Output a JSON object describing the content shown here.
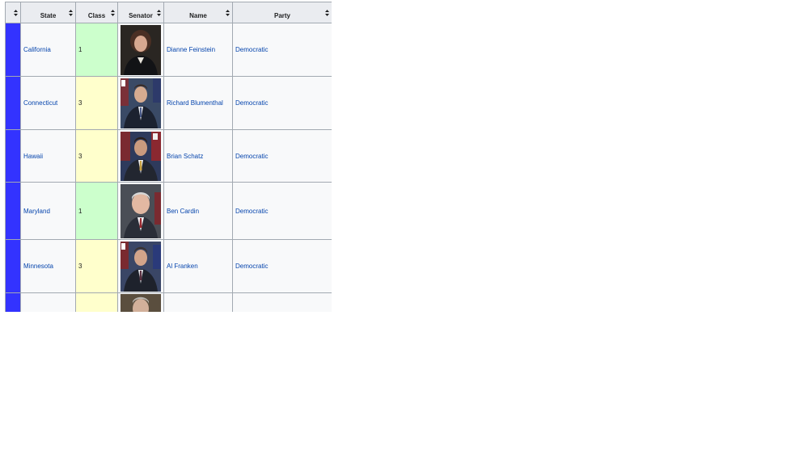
{
  "table": {
    "headers": [
      {
        "key": "color",
        "label": ""
      },
      {
        "key": "state",
        "label": "State"
      },
      {
        "key": "class",
        "label": "Class"
      },
      {
        "key": "senator",
        "label": "Senator"
      },
      {
        "key": "name",
        "label": "Name"
      },
      {
        "key": "party",
        "label": "Party"
      }
    ],
    "rows": [
      {
        "state": "California",
        "class": "1",
        "name": "Dianne Feinstein",
        "party": "Democratic",
        "photo": "senator-portrait"
      },
      {
        "state": "Connecticut",
        "class": "3",
        "name": "Richard Blumenthal",
        "party": "Democratic",
        "photo": "senator-portrait"
      },
      {
        "state": "Hawaii",
        "class": "3",
        "name": "Brian Schatz",
        "party": "Democratic",
        "photo": "senator-portrait"
      },
      {
        "state": "Maryland",
        "class": "1",
        "name": "Ben Cardin",
        "party": "Democratic",
        "photo": "senator-portrait"
      },
      {
        "state": "Minnesota",
        "class": "3",
        "name": "Al Franken",
        "party": "Democratic",
        "photo": "senator-portrait"
      },
      {
        "state": "",
        "class": "",
        "name": "",
        "party": "",
        "photo": "senator-portrait"
      }
    ]
  },
  "colors": {
    "party_democratic": "#3333ff",
    "class_1": "#ccffcc",
    "class_3": "#ffffcc",
    "link": "#0645ad",
    "header_bg": "#eaecf0",
    "cell_bg": "#f8f9fa",
    "border": "#a2a9b1"
  },
  "icons": {
    "sort": "sort-arrows-icon"
  }
}
